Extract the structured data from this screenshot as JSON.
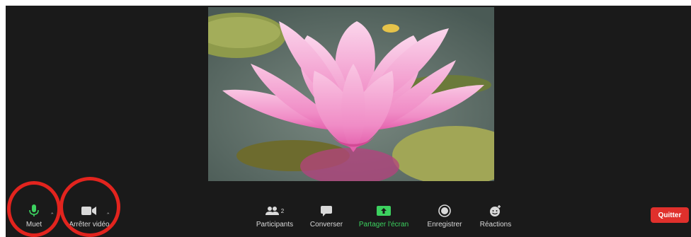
{
  "toolbar": {
    "mute_label": "Muet",
    "stop_video_label": "Arrêter vidéo",
    "participants_label": "Participants",
    "participants_count": "2",
    "chat_label": "Converser",
    "share_label": "Partager l'écran",
    "record_label": "Enregistrer",
    "reactions_label": "Réactions",
    "leave_label": "Quitter"
  },
  "icons": {
    "mute": "microphone-icon",
    "video": "video-camera-icon",
    "participants": "participants-icon",
    "chat": "chat-bubble-icon",
    "share": "share-screen-icon",
    "record": "record-icon",
    "reactions": "reactions-icon"
  },
  "colors": {
    "background": "#1a1a1a",
    "active_green": "#3cd15f",
    "leave_red": "#e0302c",
    "highlight_ring": "#e2241e"
  }
}
